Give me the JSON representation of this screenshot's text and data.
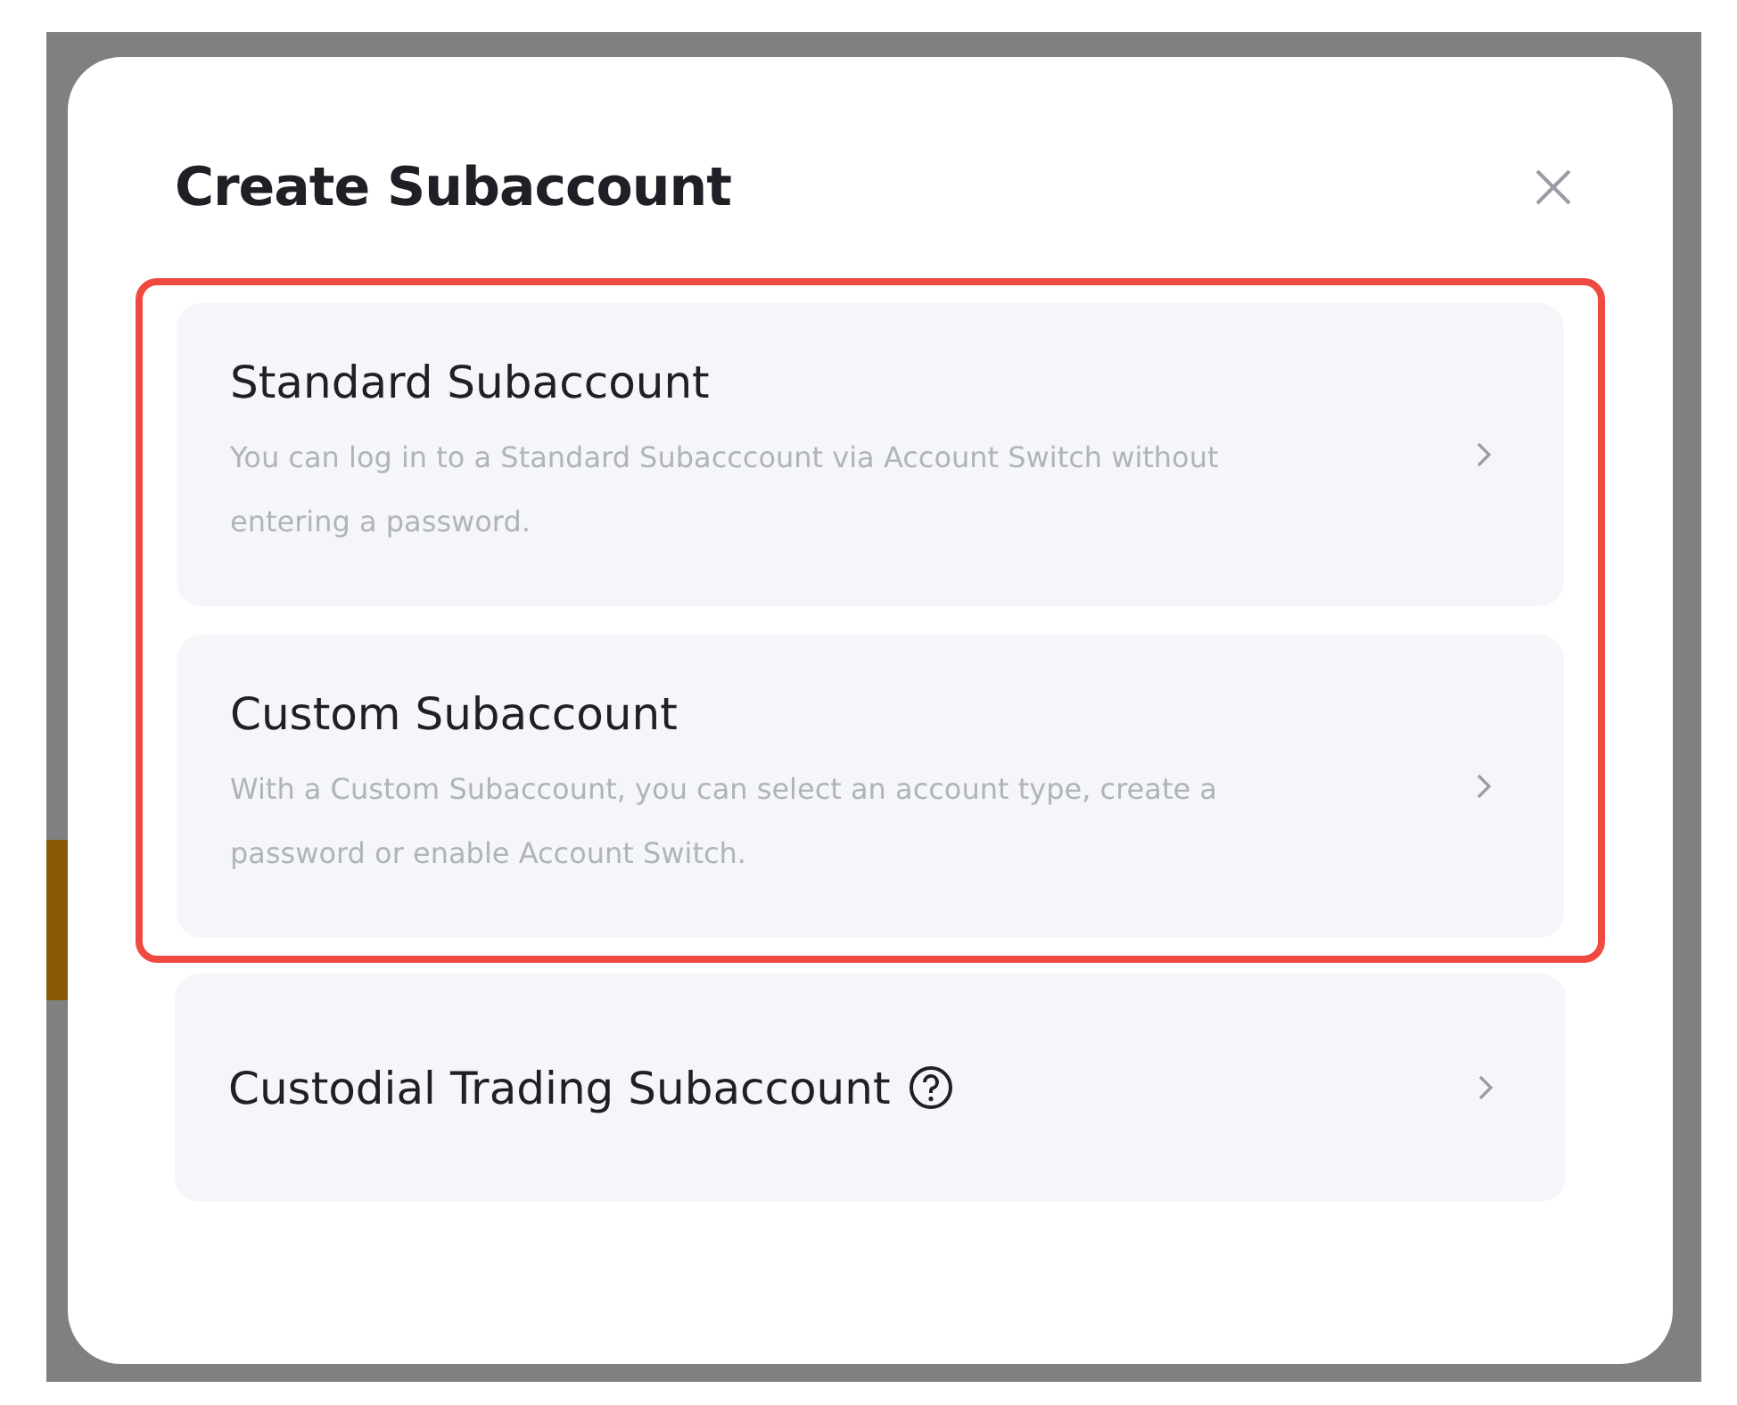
{
  "dialog": {
    "title": "Create Subaccount",
    "options": [
      {
        "title": "Standard Subaccount",
        "description": "You can log in to a Standard Subacccount via Account Switch without entering a password.",
        "highlighted": true,
        "help": false
      },
      {
        "title": "Custom Subaccount",
        "description": "With a Custom Subaccount, you can select an account type, create a password or enable Account Switch.",
        "highlighted": true,
        "help": false
      },
      {
        "title": "Custodial Trading Subaccount",
        "highlighted": false,
        "help": true
      }
    ]
  }
}
